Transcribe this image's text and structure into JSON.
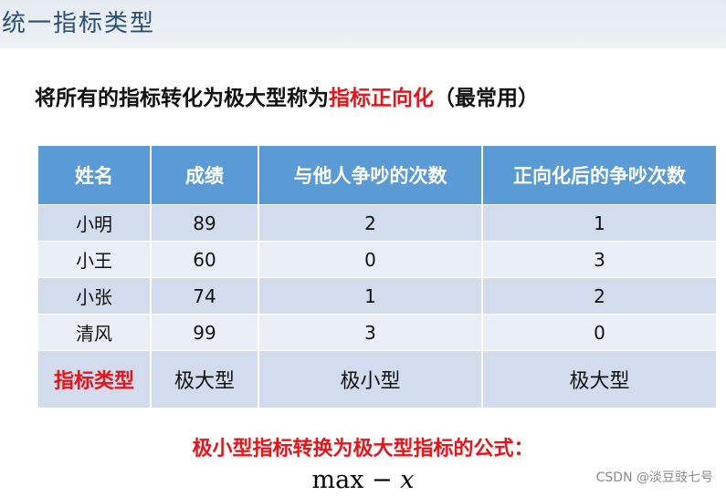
{
  "heading": "统一指标类型",
  "statement": {
    "prefix": "将所有的指标转化为极大型称为",
    "highlight": "指标正向化",
    "suffix": "（最常用）"
  },
  "table": {
    "headers": [
      "姓名",
      "成绩",
      "与他人争吵的次数",
      "正向化后的争吵次数"
    ],
    "rows": [
      [
        "小明",
        "89",
        "2",
        "1"
      ],
      [
        "小王",
        "60",
        "0",
        "3"
      ],
      [
        "小张",
        "74",
        "1",
        "2"
      ],
      [
        "清风",
        "99",
        "3",
        "0"
      ]
    ],
    "type_row": [
      "指标类型",
      "极大型",
      "极小型",
      "极大型"
    ]
  },
  "formula_caption": "极小型指标转换为极大型指标的公式：",
  "formula": {
    "op": "max",
    "minus": "−",
    "var": "x"
  },
  "watermark": "CSDN @淡豆豉七号"
}
